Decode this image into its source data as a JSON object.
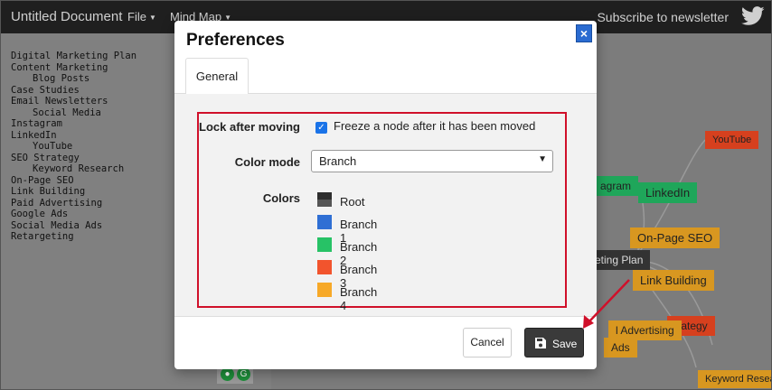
{
  "navbar": {
    "title": "Untitled Document",
    "menus": [
      {
        "label": "File"
      },
      {
        "label": "Mind Map"
      }
    ],
    "subscribe": "Subscribe to newsletter",
    "twitter_icon": "twitter-bird-icon"
  },
  "outline": {
    "items": [
      {
        "text": "Digital Marketing Plan",
        "level": 0
      },
      {
        "text": "Content Marketing",
        "level": 0
      },
      {
        "text": "Blog Posts",
        "level": 1
      },
      {
        "text": "Case Studies",
        "level": 0
      },
      {
        "text": "Email Newsletters",
        "level": 0
      },
      {
        "text": "Social Media",
        "level": 1
      },
      {
        "text": "Instagram",
        "level": 0
      },
      {
        "text": "LinkedIn",
        "level": 0
      },
      {
        "text": "YouTube",
        "level": 1
      },
      {
        "text": "SEO Strategy",
        "level": 0
      },
      {
        "text": "Keyword Research",
        "level": 1
      },
      {
        "text": "On-Page SEO",
        "level": 0
      },
      {
        "text": "Link Building",
        "level": 0
      },
      {
        "text": "Paid Advertising",
        "level": 0
      },
      {
        "text": "Google Ads",
        "level": 0
      },
      {
        "text": "Social Media Ads",
        "level": 0
      },
      {
        "text": "Retargeting",
        "level": 0
      }
    ]
  },
  "canvas_nodes": [
    {
      "text": "YouTube"
    },
    {
      "text": "agram"
    },
    {
      "text": "LinkedIn"
    },
    {
      "text": "On-Page SEO"
    },
    {
      "text": "keting Plan"
    },
    {
      "text": "Link Building"
    },
    {
      "text": "trategy"
    },
    {
      "text": "l Advertising"
    },
    {
      "text": "Ads"
    },
    {
      "text": "Keyword Resea"
    }
  ],
  "modal": {
    "title": "Preferences",
    "close_label": "×",
    "tab": "General",
    "lock_label": "Lock after moving",
    "lock_checked": true,
    "lock_text": "Freeze a node after it has been moved",
    "color_mode_label": "Color mode",
    "color_mode_value": "Branch",
    "colors_label": "Colors",
    "colors": [
      {
        "label": "Root",
        "color": "#444444"
      },
      {
        "label": "Branch 1",
        "color": "#2f6fd4"
      },
      {
        "label": "Branch 2",
        "color": "#27c266"
      },
      {
        "label": "Branch 3",
        "color": "#f2542d"
      },
      {
        "label": "Branch 4",
        "color": "#f7a928"
      }
    ],
    "cancel": "Cancel",
    "save": "Save",
    "save_icon": "floppy-disk-icon"
  },
  "annotation_color": "#d0102a"
}
